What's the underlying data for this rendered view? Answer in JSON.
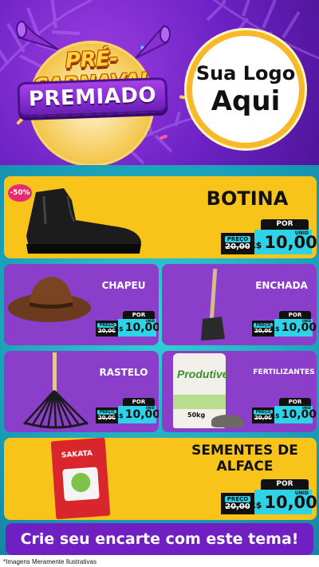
{
  "header": {
    "title_line1": "PRÉ-CARNAVAL",
    "title_line2": "PREMIADO",
    "logo_line1": "Sua Logo",
    "logo_line2": "Aqui"
  },
  "colors": {
    "purple_bg": "#6a24b5",
    "yellow_card": "#f9c41a",
    "purple_card": "#8a3ec9",
    "teal_bg": "#2fd3d6",
    "price_teal": "#2fd3e8"
  },
  "products": [
    {
      "name": "BOTINA",
      "discount": "-50%",
      "por_label": "POR",
      "preco_label": "PREÇO",
      "old_price": "20,00",
      "currency": "R$",
      "price": "10,00",
      "unit": "UNID",
      "icon": "boot-icon"
    },
    {
      "name": "CHAPEU",
      "por_label": "POR",
      "preco_label": "PREÇO",
      "old_price": "20,00",
      "currency": "R$",
      "price": "10,00",
      "unit": "UNID",
      "icon": "hat-icon"
    },
    {
      "name": "ENCHADA",
      "por_label": "POR",
      "preco_label": "PREÇO",
      "old_price": "20,00",
      "currency": "R$",
      "price": "10,00",
      "unit": "UNID",
      "icon": "hoe-icon"
    },
    {
      "name": "RASTELO",
      "por_label": "POR",
      "preco_label": "PREÇO",
      "old_price": "20,00",
      "currency": "R$",
      "price": "10,00",
      "unit": "UNID",
      "icon": "rake-icon"
    },
    {
      "name": "FERTILIZANTES",
      "por_label": "POR",
      "preco_label": "PREÇO",
      "old_price": "20,00",
      "currency": "R$",
      "price": "10,00",
      "unit": "UNID",
      "icon": "fertilizer-bag-icon",
      "bag_brand": "Produtive",
      "bag_weight": "50kg"
    },
    {
      "name_line1": "SEMENTES DE",
      "name_line2": "ALFACE",
      "por_label": "POR",
      "preco_label": "PREÇO",
      "old_price": "20,00",
      "currency": "R$",
      "price": "10,00",
      "unit": "UNID",
      "icon": "seed-packet-icon",
      "packet_brand": "SAKATA"
    }
  ],
  "footer": {
    "cta": "Crie seu encarte com este tema!",
    "disclaimer": "*Imagens Meramente Ilustrativas"
  }
}
